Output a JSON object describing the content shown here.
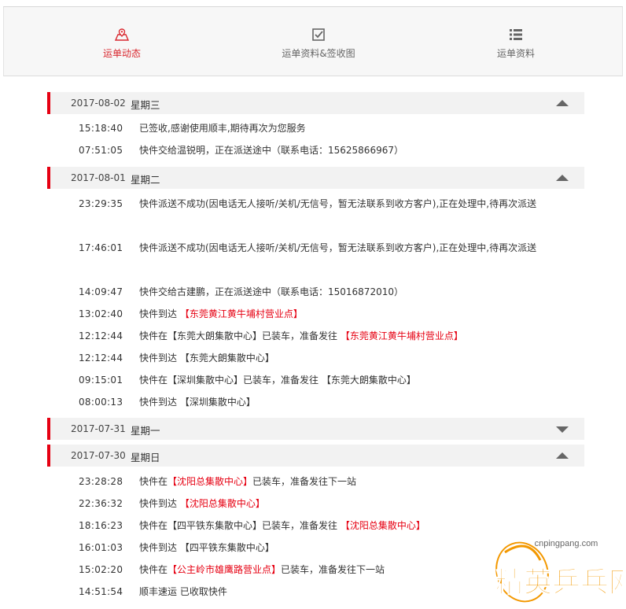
{
  "tabs": [
    {
      "label": "运单动态",
      "icon": "map-route-icon",
      "active": true
    },
    {
      "label": "运单资料&签收图",
      "icon": "signed-checkbox-icon",
      "active": false
    },
    {
      "label": "运单资料",
      "icon": "list-icon",
      "active": false
    }
  ],
  "days": [
    {
      "date": "2017-08-02",
      "week": "星期三",
      "expanded": true,
      "events": [
        {
          "time": "15:18:40",
          "parts": [
            {
              "text": "已签收,感谢使用顺丰,期待再次为您服务"
            }
          ]
        },
        {
          "time": "07:51:05",
          "parts": [
            {
              "text": "快件交给温锐明，正在派送途中（联系电话：15625866967）"
            }
          ]
        }
      ]
    },
    {
      "date": "2017-08-01",
      "week": "星期二",
      "expanded": true,
      "events": [
        {
          "time": "23:29:35",
          "parts": [
            {
              "text": "快件派送不成功(因电话无人接听/关机/无信号，暂无法联系到收方客户),正在处理中,待再次派送"
            }
          ]
        },
        {
          "time": "17:46:01",
          "parts": [
            {
              "text": "快件派送不成功(因电话无人接听/关机/无信号，暂无法联系到收方客户),正在处理中,待再次派送"
            }
          ]
        },
        {
          "time": "14:09:47",
          "parts": [
            {
              "text": "快件交给古建鹏，正在派送途中（联系电话：15016872010）"
            }
          ]
        },
        {
          "time": "13:02:40",
          "parts": [
            {
              "text": "快件到达 "
            },
            {
              "text": "【东莞黄江黄牛埔村营业点】",
              "red": true
            }
          ]
        },
        {
          "time": "12:12:44",
          "parts": [
            {
              "text": "快件在【东莞大朗集散中心】已装车，准备发往 "
            },
            {
              "text": "【东莞黄江黄牛埔村营业点】",
              "red": true
            }
          ]
        },
        {
          "time": "12:12:44",
          "parts": [
            {
              "text": "快件到达 【东莞大朗集散中心】"
            }
          ]
        },
        {
          "time": "09:15:01",
          "parts": [
            {
              "text": "快件在【深圳集散中心】已装车，准备发往 【东莞大朗集散中心】"
            }
          ]
        },
        {
          "time": "08:00:13",
          "parts": [
            {
              "text": "快件到达 【深圳集散中心】"
            }
          ]
        }
      ]
    },
    {
      "date": "2017-07-31",
      "week": "星期一",
      "expanded": false,
      "events": []
    },
    {
      "date": "2017-07-30",
      "week": "星期日",
      "expanded": true,
      "events": [
        {
          "time": "23:28:28",
          "parts": [
            {
              "text": "快件在"
            },
            {
              "text": "【沈阳总集散中心】",
              "red": true
            },
            {
              "text": "已装车，准备发往下一站"
            }
          ]
        },
        {
          "time": "22:36:32",
          "parts": [
            {
              "text": "快件到达 "
            },
            {
              "text": "【沈阳总集散中心】",
              "red": true
            }
          ]
        },
        {
          "time": "18:16:23",
          "parts": [
            {
              "text": "快件在【四平铁东集散中心】已装车，准备发往 "
            },
            {
              "text": "【沈阳总集散中心】",
              "red": true
            }
          ]
        },
        {
          "time": "16:01:03",
          "parts": [
            {
              "text": "快件到达 【四平铁东集散中心】"
            }
          ]
        },
        {
          "time": "15:02:20",
          "parts": [
            {
              "text": "快件在"
            },
            {
              "text": "【公主岭市雄鹰路营业点】",
              "red": true
            },
            {
              "text": "已装车，准备发往下一站"
            }
          ]
        },
        {
          "time": "14:51:54",
          "parts": [
            {
              "text": "顺丰速运 已收取快件"
            }
          ]
        }
      ]
    }
  ],
  "watermark": {
    "url": "cnpingpang.com",
    "text": "精英乒乓网",
    "colors": {
      "orange": "#f39800",
      "red": "#e60012"
    }
  }
}
